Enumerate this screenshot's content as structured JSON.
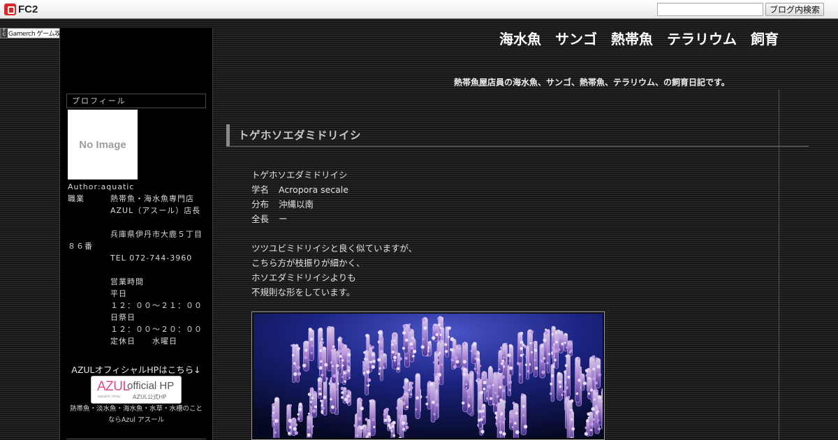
{
  "topbar": {
    "logo_text": "FC2",
    "search_placeholder": "",
    "search_button": "ブログ内検索"
  },
  "wiki_badge": {
    "label": "Gamerch ゲーム攻略Wiki"
  },
  "header": {
    "title": "海水魚　サンゴ　熱帯魚　テラリウム　飼育",
    "description": "熱帯魚屋店員の海水魚、サンゴ、熱帯魚、テラリウム、の飼育日記です。"
  },
  "sidebar": {
    "profile_heading": "プロフィール",
    "no_image_text": "No Image",
    "author": "Author:aquatic",
    "job_label": "職業",
    "job_line1": "熱帯魚・海水魚専門店",
    "job_line2": "AZUL（アスール）店長",
    "address_line1": "兵庫県伊丹市大鹿５丁目",
    "address_line2": "８６番",
    "tel": "TEL 072-744-3960",
    "hours_label": "営業時間",
    "weekday_label": "平日",
    "weekday_hours": "１２：００～２１：００",
    "holiday_label": "日祭日",
    "holiday_hours": "１２：００〜２０：００",
    "closed": "定休日　　水曜日",
    "azul_link_text": "AZULオフィシャルHPはこちら↓",
    "banner_logo": "AZUL",
    "banner_logo_sub": "aquatic shop",
    "banner_official": "official HP",
    "banner_official_sub": "AZUL公式HP",
    "azul_caption_line1": "熱帯魚・淡水魚・海水魚・水草・水槽のこと",
    "azul_caption_line2": "ならAzul アスール"
  },
  "entry": {
    "title": "トゲホソエダミドリイシ",
    "name_line": "トゲホソエダミドリイシ",
    "sci_label": "学名",
    "sci_value": "Acropora secale",
    "dist_label": "分布",
    "dist_value": "沖縄以南",
    "len_label": "全長",
    "len_value": "ー",
    "desc_line1": "ツツユビミドリイシと良く似ていますが、",
    "desc_line2": "こちら方が枝振りが細かく、",
    "desc_line3": "ホソエダミドリイシよりも",
    "desc_line4": "不規則な形をしています。"
  }
}
